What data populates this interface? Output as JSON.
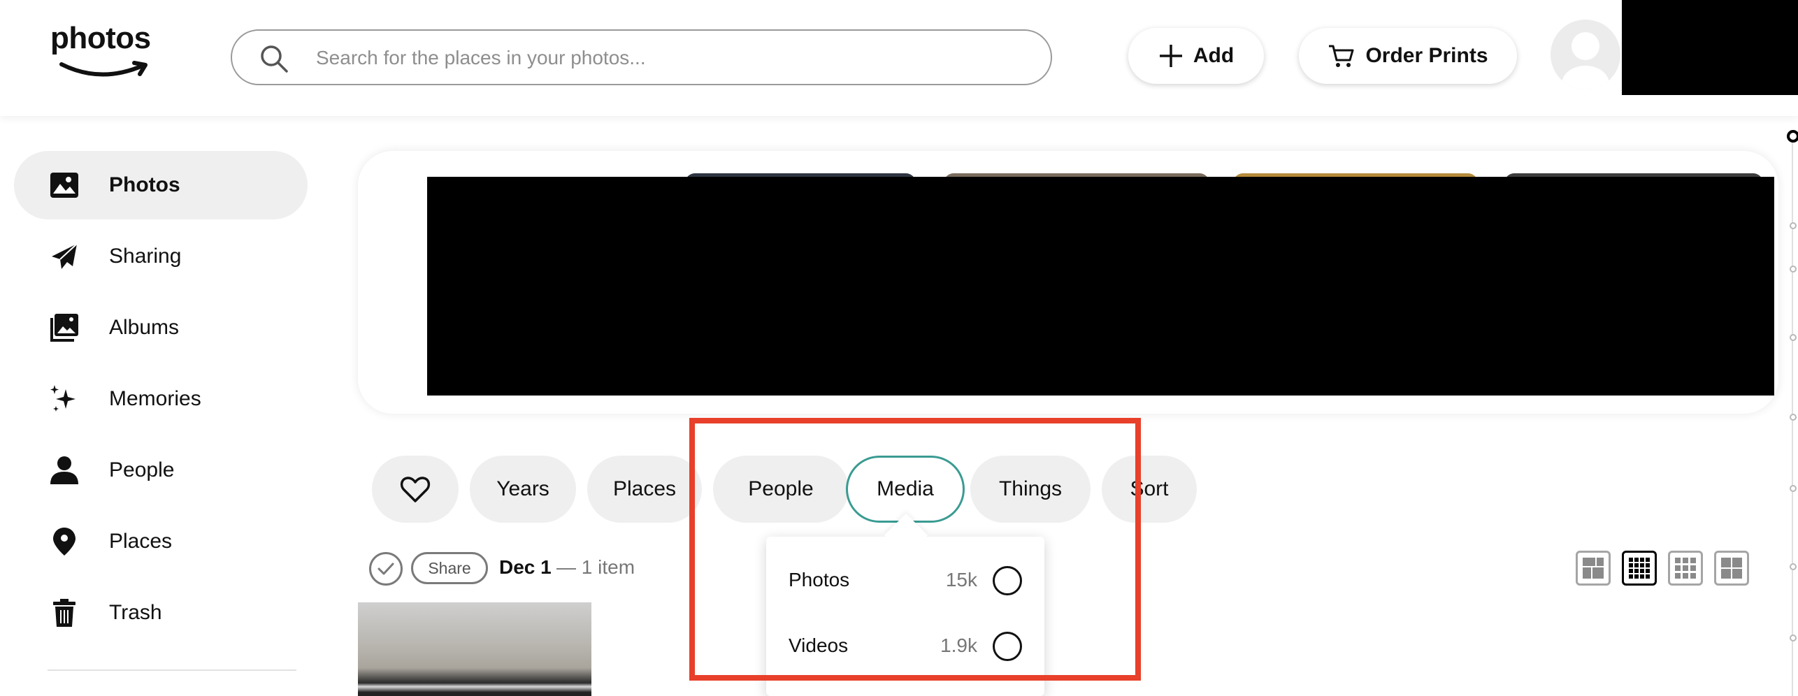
{
  "header": {
    "logo_text": "photos",
    "search": {
      "placeholder": "Search for the places in your photos..."
    },
    "add_label": "Add",
    "order_prints_label": "Order Prints"
  },
  "sidebar": {
    "items": [
      {
        "label": "Photos",
        "icon": "photo-icon",
        "active": true
      },
      {
        "label": "Sharing",
        "icon": "paper-plane-icon"
      },
      {
        "label": "Albums",
        "icon": "album-icon"
      },
      {
        "label": "Memories",
        "icon": "sparkle-icon"
      },
      {
        "label": "People",
        "icon": "person-icon"
      },
      {
        "label": "Places",
        "icon": "location-pin-icon"
      },
      {
        "label": "Trash",
        "icon": "trash-icon"
      }
    ]
  },
  "filters": {
    "chips": [
      {
        "label": "",
        "icon": "heart-icon"
      },
      {
        "label": "Years"
      },
      {
        "label": "Places"
      },
      {
        "label": "People"
      },
      {
        "label": "Media",
        "selected": true
      },
      {
        "label": "Things"
      },
      {
        "label": "Sort"
      }
    ]
  },
  "date_group": {
    "share_label": "Share",
    "date": "Dec 1",
    "count": "— 1 item"
  },
  "media_dropdown": {
    "options": [
      {
        "label": "Photos",
        "count": "15k"
      },
      {
        "label": "Videos",
        "count": "1.9k"
      }
    ]
  },
  "colors": {
    "accent_teal": "#3a9b92",
    "highlight_red": "#e8402a",
    "chip_bg": "#efefef"
  }
}
